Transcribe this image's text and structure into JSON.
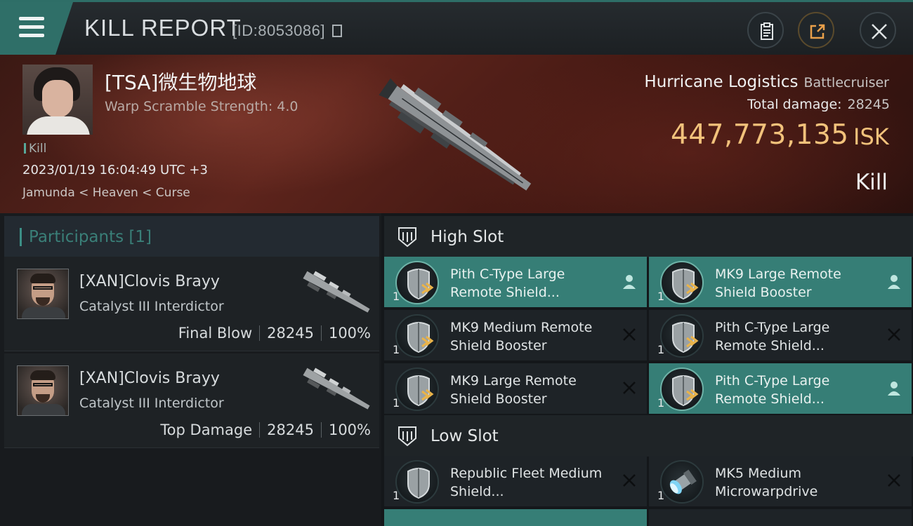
{
  "header": {
    "title": "KILL REPORT",
    "id_label": "[ID:8053086]"
  },
  "victim": {
    "name": "[TSA]微生物地球",
    "scramble": "Warp Scramble Strength: 4.0",
    "kill_tag": "Kill",
    "datetime": "2023/01/19 16:04:49 UTC +3",
    "location": "Jamunda < Heaven < Curse",
    "ship_name": "Hurricane Logistics",
    "ship_class": "Battlecruiser",
    "total_damage_label": "Total damage:",
    "total_damage_value": "28245",
    "isk_value": "447,773,135",
    "isk_unit": "ISK",
    "result": "Kill"
  },
  "participants": {
    "header": "Participants [1]",
    "rows": [
      {
        "name": "[XAN]Clovis Brayy",
        "ship": "Catalyst III Interdictor",
        "role": "Final Blow",
        "damage": "28245",
        "percent": "100%"
      },
      {
        "name": "[XAN]Clovis Brayy",
        "ship": "Catalyst III Interdictor",
        "role": "Top Damage",
        "damage": "28245",
        "percent": "100%"
      }
    ]
  },
  "fitting": {
    "high_slot_label": "High Slot",
    "low_slot_label": "Low Slot",
    "high_modules": [
      {
        "name": "Pith C-Type Large Remote Shield...",
        "qty": "1",
        "status": "fitted",
        "icon": "shield-booster-icon"
      },
      {
        "name": "MK9 Large Remote Shield Booster",
        "qty": "1",
        "status": "fitted",
        "icon": "shield-booster-icon"
      },
      {
        "name": "MK9 Medium Remote Shield Booster",
        "qty": "1",
        "status": "destroyed",
        "icon": "shield-booster-icon"
      },
      {
        "name": "Pith C-Type Large Remote Shield...",
        "qty": "1",
        "status": "destroyed",
        "icon": "shield-booster-icon"
      },
      {
        "name": "MK9 Large Remote Shield Booster",
        "qty": "1",
        "status": "destroyed",
        "icon": "shield-booster-icon"
      },
      {
        "name": "Pith C-Type Large Remote Shield...",
        "qty": "1",
        "status": "fitted",
        "icon": "shield-booster-icon"
      }
    ],
    "low_modules": [
      {
        "name": "Republic Fleet Medium Shield...",
        "qty": "1",
        "status": "destroyed",
        "icon": "shield-extender-icon"
      },
      {
        "name": "MK5 Medium Microwarpdrive",
        "qty": "1",
        "status": "destroyed",
        "icon": "microwarpdrive-icon"
      }
    ]
  },
  "colors": {
    "accent_teal": "#367e76",
    "isk_gold": "#f2c27b",
    "banner_red": "#5d241c"
  }
}
